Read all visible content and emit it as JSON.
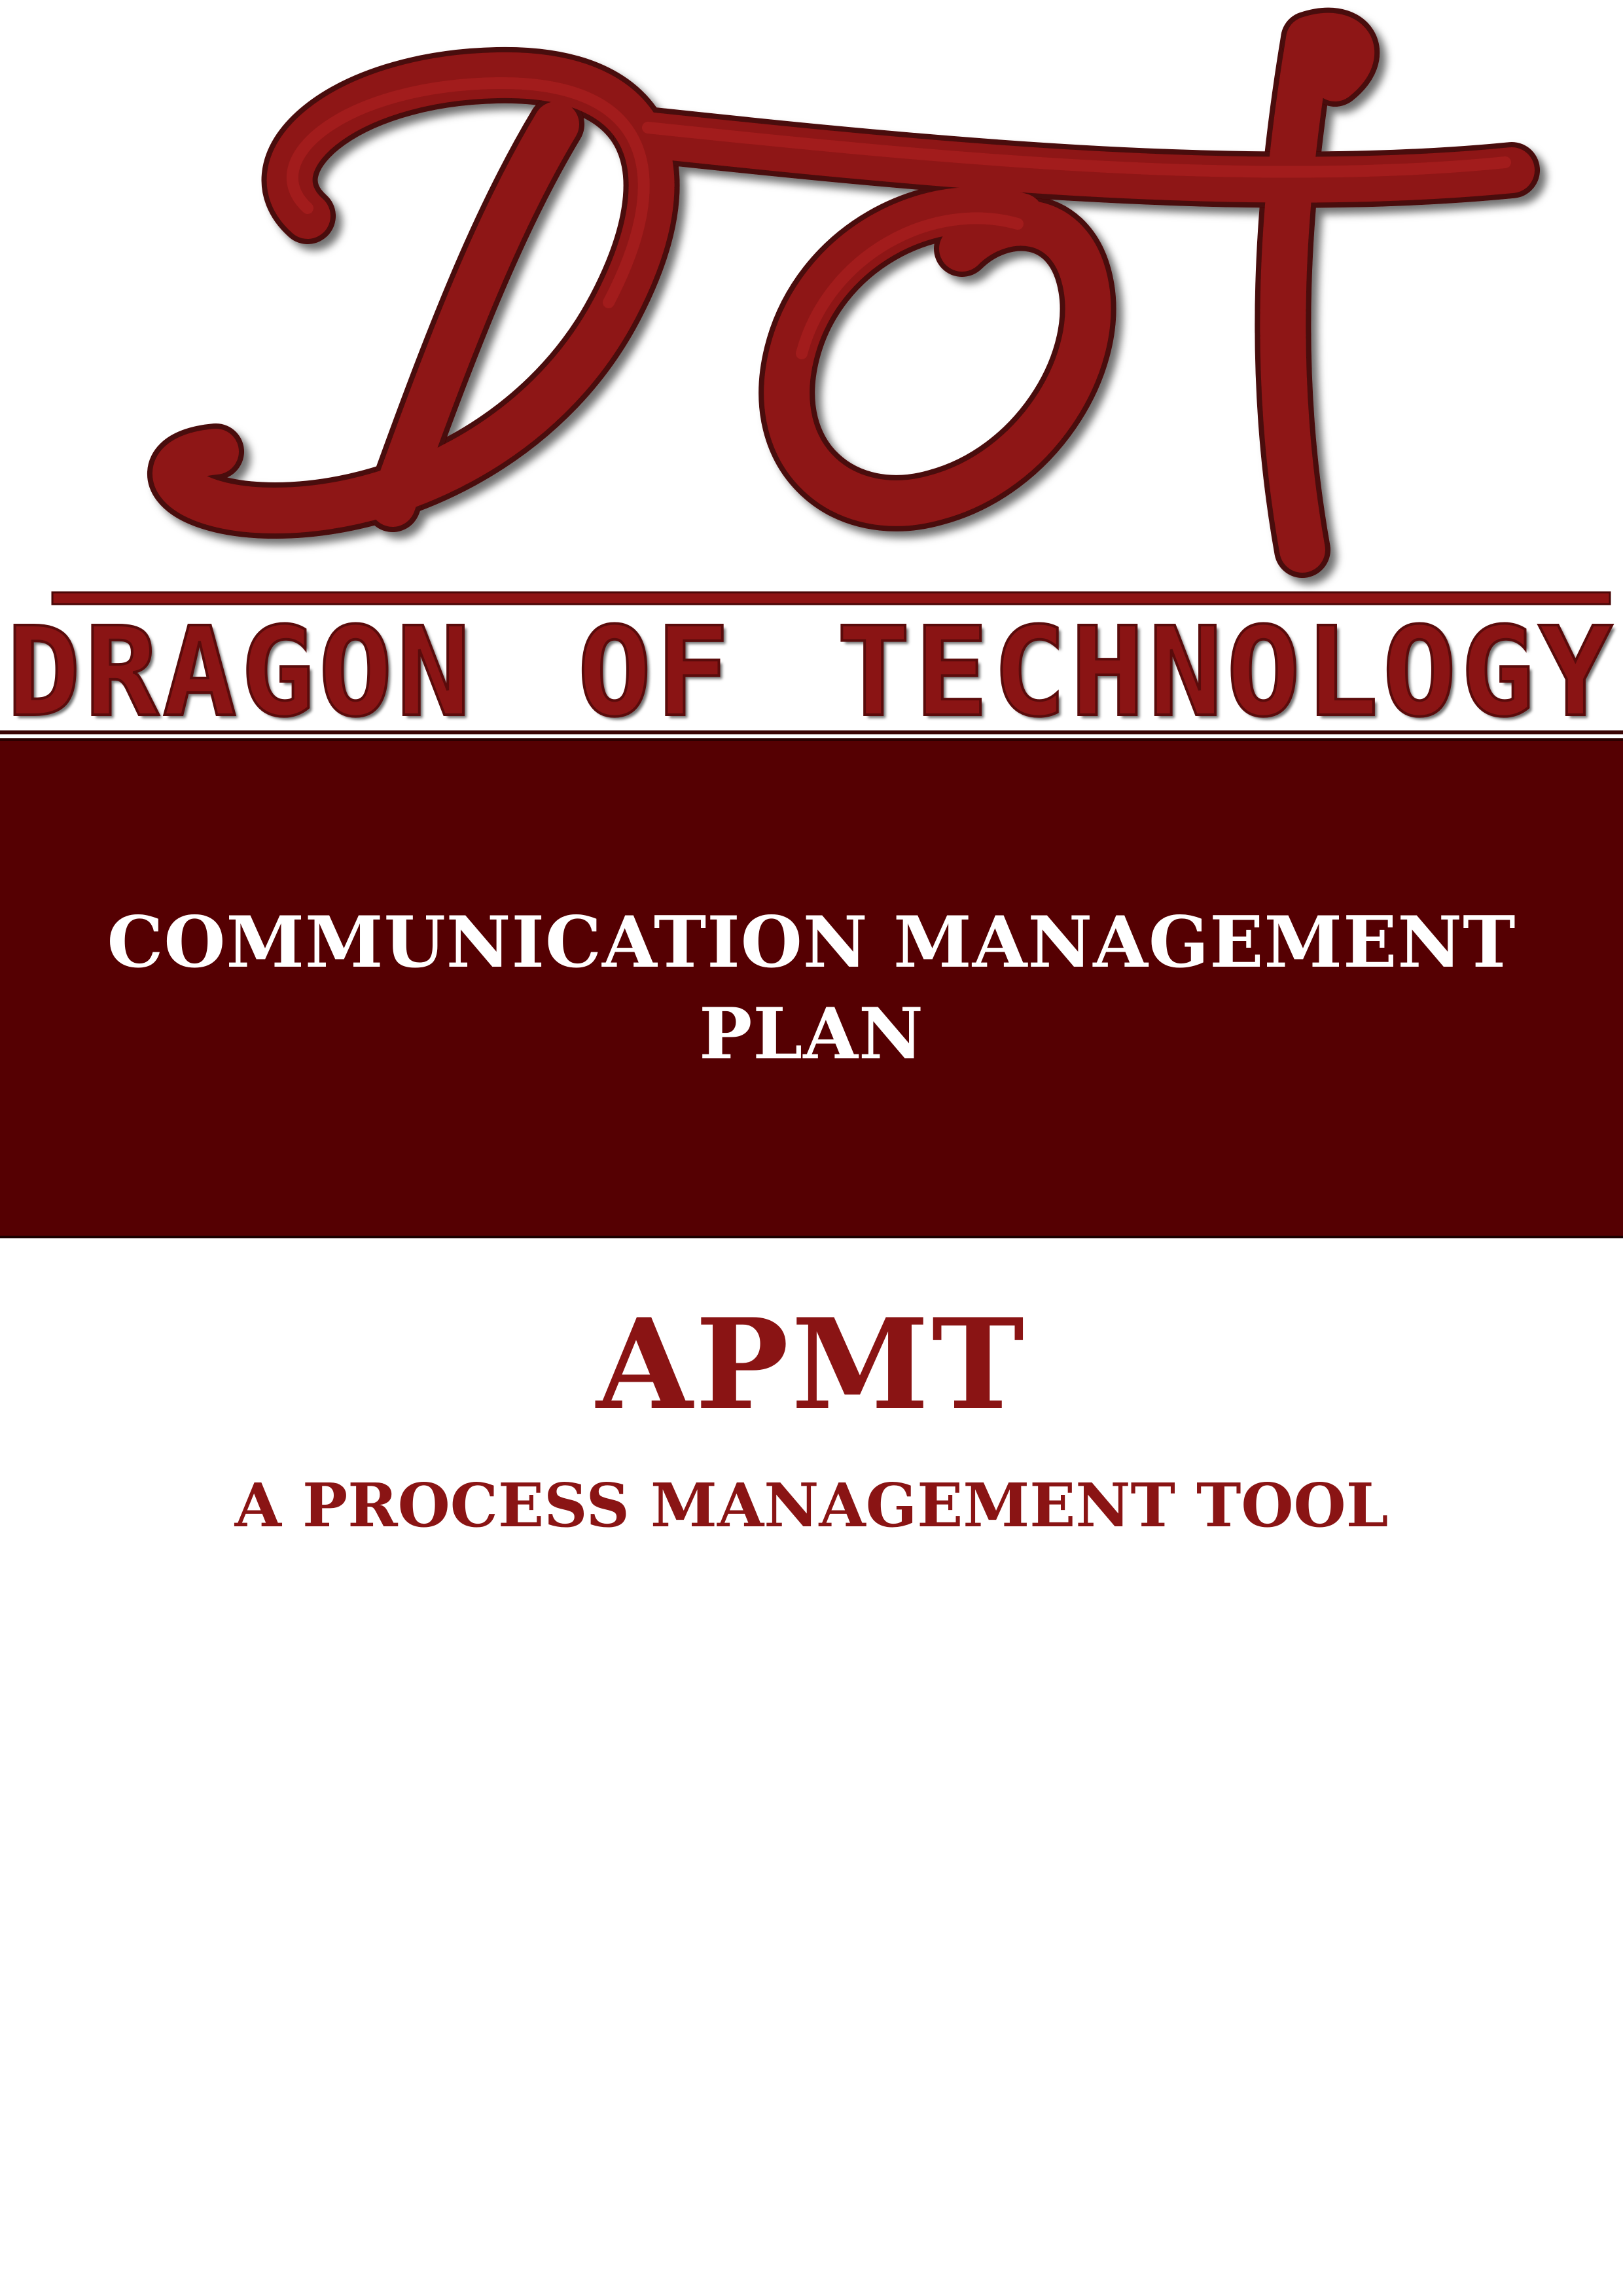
{
  "logo": {
    "monogram_text": "DOT",
    "wordmark": "DRAGON OF TECHNOLOGY",
    "wordmark_words": [
      "DRAGON",
      "OF",
      "TECHNOLOGY"
    ],
    "color": "#8a1414"
  },
  "title_band": {
    "title_line1": "COMMUNICATION MANAGEMENT",
    "title_line2": "PLAN",
    "background_color": "#550002",
    "text_color": "#ffffff"
  },
  "product": {
    "name": "APMT",
    "subtitle": "A PROCESS MANAGEMENT TOOL",
    "color": "#8a1414"
  }
}
